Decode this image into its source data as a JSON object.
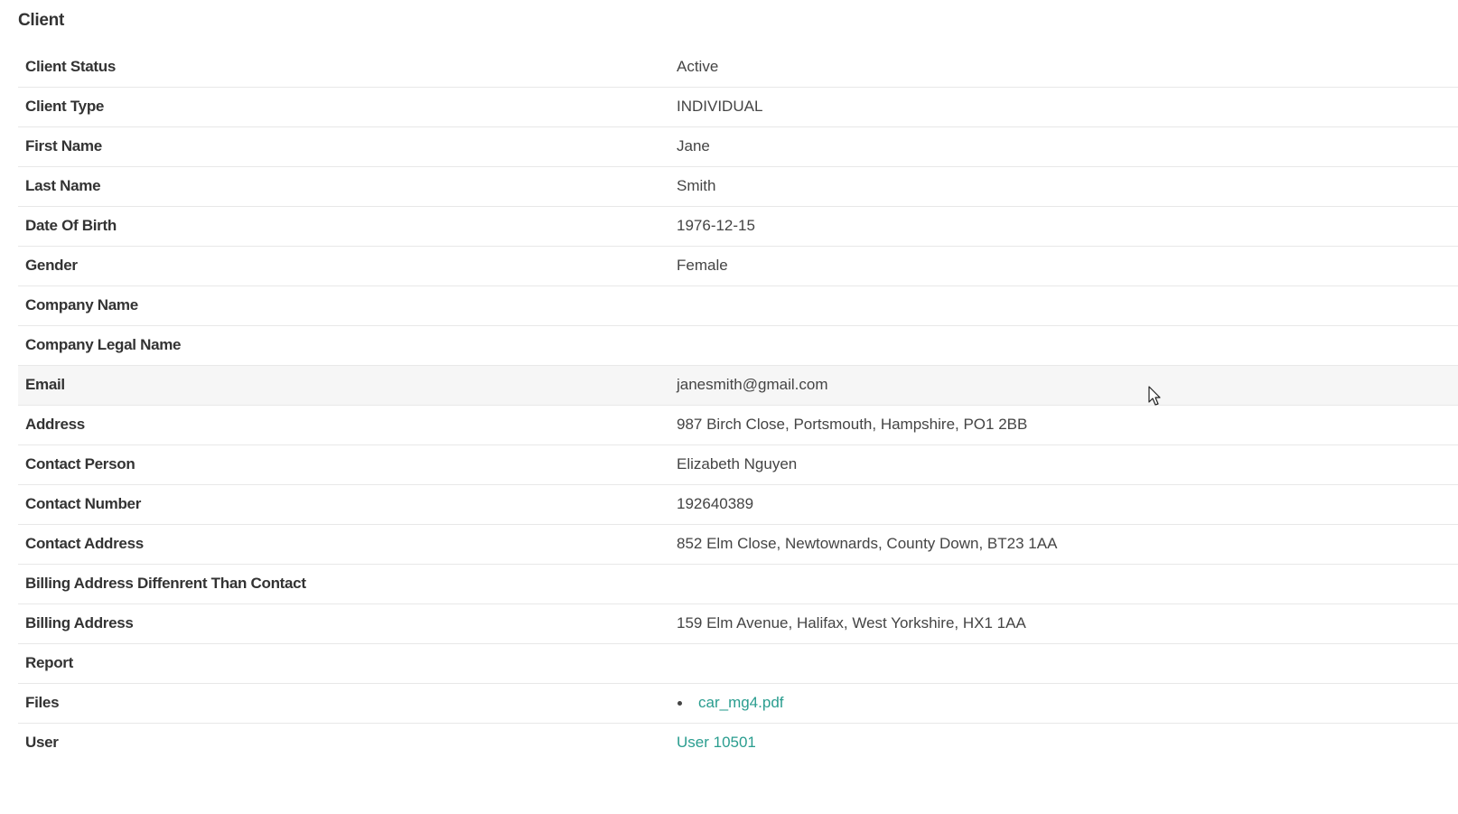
{
  "section": {
    "title": "Client"
  },
  "details": {
    "client_status": {
      "label": "Client Status",
      "value": "Active"
    },
    "client_type": {
      "label": "Client Type",
      "value": "INDIVIDUAL"
    },
    "first_name": {
      "label": "First Name",
      "value": "Jane"
    },
    "last_name": {
      "label": "Last Name",
      "value": "Smith"
    },
    "date_of_birth": {
      "label": "Date Of Birth",
      "value": "1976-12-15"
    },
    "gender": {
      "label": "Gender",
      "value": "Female"
    },
    "company_name": {
      "label": "Company Name",
      "value": ""
    },
    "company_legal_name": {
      "label": "Company Legal Name",
      "value": ""
    },
    "email": {
      "label": "Email",
      "value": "janesmith@gmail.com"
    },
    "address": {
      "label": "Address",
      "value": "987 Birch Close, Portsmouth, Hampshire, PO1 2BB"
    },
    "contact_person": {
      "label": "Contact Person",
      "value": "Elizabeth Nguyen"
    },
    "contact_number": {
      "label": "Contact Number",
      "value": "192640389"
    },
    "contact_address": {
      "label": "Contact Address",
      "value": "852 Elm Close, Newtownards, County Down, BT23 1AA"
    },
    "billing_different": {
      "label": "Billing Address Diffenrent Than Contact",
      "value": ""
    },
    "billing_address": {
      "label": "Billing Address",
      "value": "159 Elm Avenue, Halifax, West Yorkshire, HX1 1AA"
    },
    "report": {
      "label": "Report",
      "value": ""
    },
    "files": {
      "label": "Files",
      "items": [
        "car_mg4.pdf"
      ]
    },
    "user": {
      "label": "User",
      "value": "User 10501"
    }
  },
  "colors": {
    "link": "#2a9d8f",
    "label_text": "#333333",
    "value_text": "#444444",
    "row_divider": "#e8e8e8",
    "hover_row": "#f6f6f6"
  },
  "cursor": {
    "icon": "mouse-pointer-icon"
  }
}
